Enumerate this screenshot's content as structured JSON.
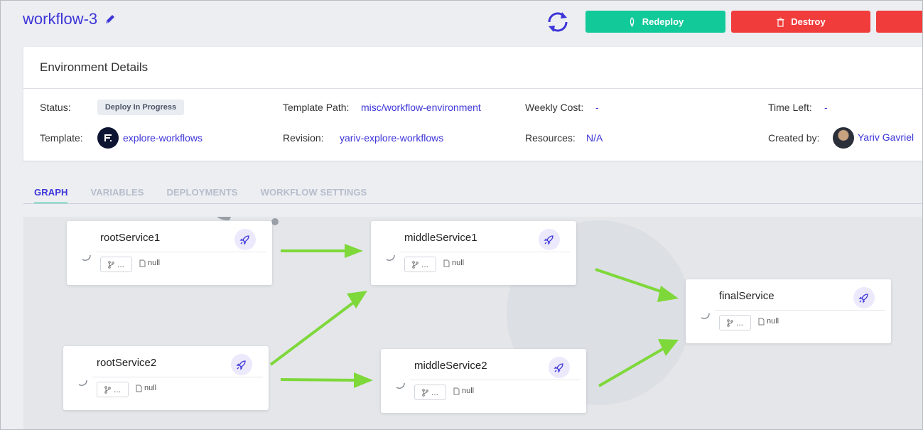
{
  "header": {
    "title": "workflow-3",
    "redeploy_label": "Redeploy",
    "destroy_label": "Destroy"
  },
  "env": {
    "heading": "Environment Details",
    "status_label": "Status:",
    "status_value": "Deploy In Progress",
    "template_label": "Template:",
    "template_value": "explore-workflows",
    "template_path_label": "Template Path:",
    "template_path_value": "misc/workflow-environment",
    "revision_label": "Revision:",
    "revision_value": "yariv-explore-workflows",
    "weekly_cost_label": "Weekly Cost:",
    "weekly_cost_value": "-",
    "resources_label": "Resources:",
    "resources_value": "N/A",
    "time_left_label": "Time Left:",
    "time_left_value": "-",
    "created_by_label": "Created by:",
    "created_by_value": "Yariv Gavriel"
  },
  "tabs": [
    {
      "label": "GRAPH",
      "active": true
    },
    {
      "label": "VARIABLES",
      "active": false
    },
    {
      "label": "DEPLOYMENTS",
      "active": false
    },
    {
      "label": "WORKFLOW SETTINGS",
      "active": false
    }
  ],
  "graph": {
    "nodes": [
      {
        "name": "rootService1",
        "branch": "...",
        "revision": "null"
      },
      {
        "name": "rootService2",
        "branch": "...",
        "revision": "null"
      },
      {
        "name": "middleService1",
        "branch": "...",
        "revision": "null"
      },
      {
        "name": "middleService2",
        "branch": "...",
        "revision": "null"
      },
      {
        "name": "finalService",
        "branch": "...",
        "revision": "null"
      }
    ],
    "edges": [
      {
        "from": "rootService1",
        "to": "middleService1"
      },
      {
        "from": "rootService2",
        "to": "middleService1"
      },
      {
        "from": "rootService2",
        "to": "middleService2"
      },
      {
        "from": "middleService1",
        "to": "finalService"
      },
      {
        "from": "middleService2",
        "to": "finalService"
      }
    ]
  },
  "colors": {
    "accent": "#3d35d8",
    "redeploy": "#12c99a",
    "destroy": "#f13c3c",
    "arrow": "#7ed83a"
  }
}
